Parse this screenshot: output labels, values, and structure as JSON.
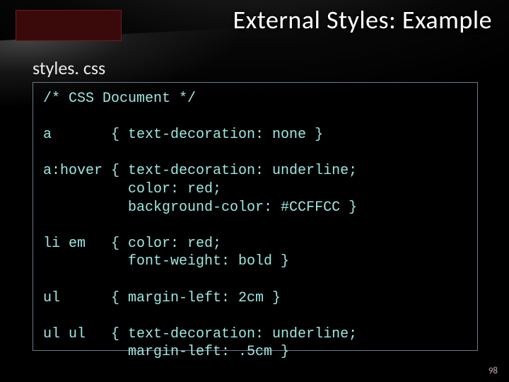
{
  "title": "External Styles: Example",
  "filename": "styles. css",
  "code": {
    "line01": "/* CSS Document */",
    "line02": "",
    "line03": "a       { text-decoration: none }",
    "line04": "",
    "line05": "a:hover { text-decoration: underline;",
    "line06": "          color: red;",
    "line07": "          background-color: #CCFFCC }",
    "line08": "",
    "line09": "li em   { color: red;",
    "line10": "          font-weight: bold }",
    "line11": "",
    "line12": "ul      { margin-left: 2cm }",
    "line13": "",
    "line14": "ul ul   { text-decoration: underline;",
    "line15": "          margin-left: .5cm }"
  },
  "page_number": "98"
}
